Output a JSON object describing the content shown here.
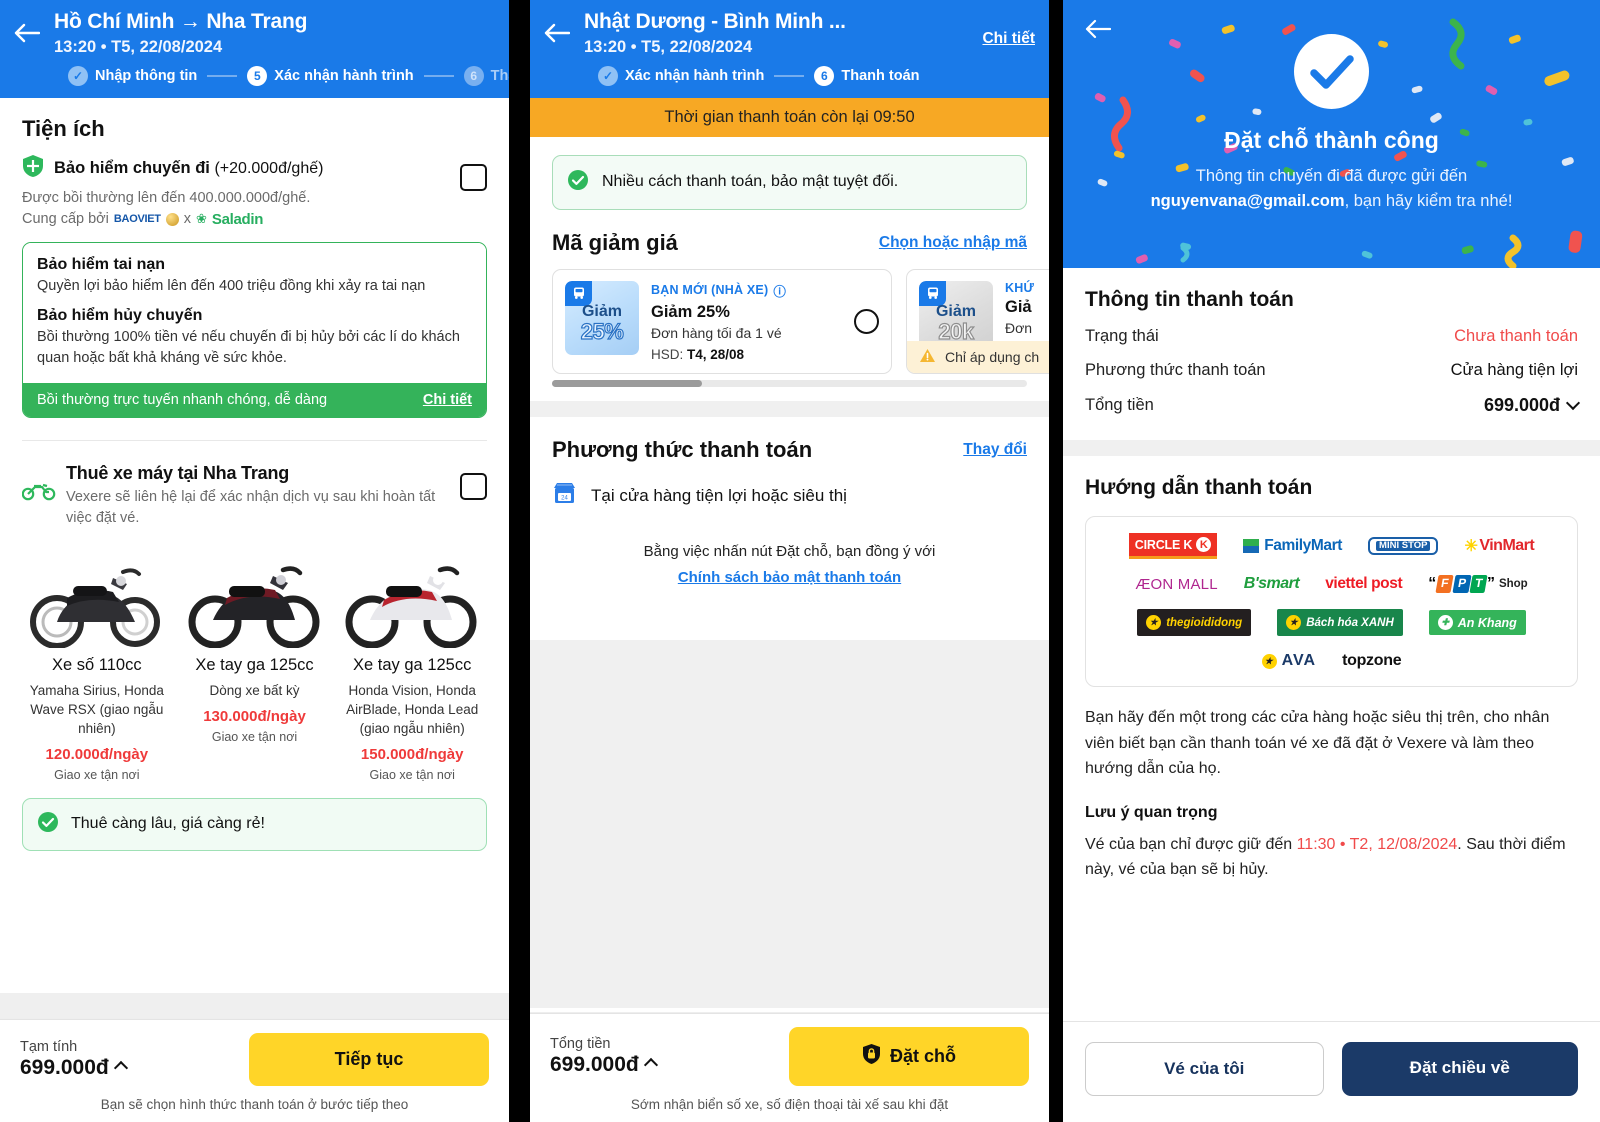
{
  "panel1": {
    "header": {
      "title": "Hồ Chí Minh → Nha Trang",
      "subtitle": "13:20 • T5, 22/08/2024",
      "steps": [
        {
          "bullet": "✓",
          "label": "Nhập thông tin",
          "state": "done"
        },
        {
          "bullet": "5",
          "label": "Xác nhận hành trình",
          "state": "current"
        },
        {
          "bullet": "6",
          "label": "Thanh",
          "state": "next"
        }
      ]
    },
    "section_title": "Tiện ích",
    "trip_insurance": {
      "title": "Bảo hiểm chuyến đi",
      "price_suffix": "(+20.000đ/ghế)",
      "desc": "Được bồi thường lên đến 400.000.000đ/ghế.",
      "provided_by_label": "Cung cấp bởi",
      "provider_1": "BAOVIET",
      "provider_sep": "x",
      "provider_2": "Saladin"
    },
    "insurance_card": {
      "accident_title": "Bảo hiểm tai nạn",
      "accident_desc": "Quyền lợi bảo hiểm lên đến 400 triệu đồng khi xảy ra tai nạn",
      "cancel_title": "Bảo hiểm hủy chuyến",
      "cancel_desc": "Bồi thường 100% tiền vé nếu chuyến đi bị hủy bởi các lí do khách quan hoặc bất khả kháng về sức khỏe.",
      "footer_text": "Bồi thường trực tuyến nhanh chóng, dễ dàng",
      "footer_link": "Chi tiết"
    },
    "bike_rental": {
      "title": "Thuê xe máy tại Nha Trang",
      "subtitle": "Vexere sẽ liên hệ lại để xác nhận dịch vụ sau khi hoàn tất việc đặt vé.",
      "items": [
        {
          "name": "Xe số 110cc",
          "models": "Yamaha Sirius, Honda Wave RSX (giao ngẫu nhiên)",
          "price": "120.000đ/ngày",
          "shipping": "Giao xe tận nơi"
        },
        {
          "name": "Xe tay ga 125cc",
          "models": "Dòng xe bất kỳ",
          "price": "130.000đ/ngày",
          "shipping": "Giao xe tận nơi"
        },
        {
          "name": "Xe tay ga 125cc",
          "models": "Honda Vision, Honda AirBlade, Honda Lead (giao ngẫu nhiên)",
          "price": "150.000đ/ngày",
          "shipping": "Giao xe tận nơi"
        }
      ],
      "hint": "Thuê càng lâu, giá càng rẻ!"
    },
    "bottom": {
      "label": "Tạm tính",
      "amount": "699.000đ",
      "cta": "Tiếp tục",
      "note": "Bạn sẽ chọn hình thức thanh toán ở bước tiếp theo"
    }
  },
  "panel2": {
    "header": {
      "title": "Nhật Dương - Bình Minh ...",
      "subtitle": "13:20 • T5, 22/08/2024",
      "right_link": "Chi tiết",
      "steps": [
        {
          "bullet": "✓",
          "label": "Xác nhận hành trình",
          "state": "done"
        },
        {
          "bullet": "6",
          "label": "Thanh toán",
          "state": "current"
        }
      ]
    },
    "timer": "Thời gian thanh toán còn lại 09:50",
    "secure_note": "Nhiều cách thanh toán, bảo mật tuyệt đối.",
    "promo": {
      "title": "Mã giảm giá",
      "link": "Chọn hoặc nhập mã",
      "coupons": [
        {
          "img_line1": "Giảm",
          "img_line2": "25%",
          "tag": "BẠN MỚI (NHÀ XE)",
          "title": "Giảm 25%",
          "sub": "Đơn hàng tối đa 1 vé",
          "expiry_label": "HSD:",
          "expiry": "T4, 28/08",
          "warning": ""
        },
        {
          "img_line1": "Giảm",
          "img_line2": "20k",
          "tag": "KHỨ",
          "title": "Giả",
          "sub": "Đơn",
          "expiry_label": "",
          "expiry": "",
          "warning": "Chỉ áp dụng ch"
        }
      ]
    },
    "payment": {
      "title": "Phương thức thanh toán",
      "change_link": "Thay đổi",
      "method": "Tại cửa hàng tiện lợi hoặc siêu thị",
      "agree_prefix": "Bằng việc nhấn nút Đặt chỗ, bạn đồng ý với",
      "agree_link": "Chính sách bảo mật thanh toán"
    },
    "bottom": {
      "label": "Tổng tiền",
      "amount": "699.000đ",
      "cta": "Đặt chỗ",
      "note": "Sớm nhận biển số xe, số điện thoại tài xế sau khi đặt"
    }
  },
  "panel3": {
    "hero": {
      "title": "Đặt chỗ thành công",
      "line1": "Thông tin chuyến đi đã được gửi đến",
      "email": "nguyenvana@gmail.com",
      "line2": ", bạn hãy kiểm tra nhé!"
    },
    "payment_info": {
      "title": "Thông tin thanh toán",
      "rows": [
        {
          "key": "Trạng thái",
          "value": "Chưa thanh toán",
          "style": "red"
        },
        {
          "key": "Phương thức thanh toán",
          "value": "Cửa hàng tiện lợi",
          "style": "plain"
        },
        {
          "key": "Tổng tiền",
          "value": "699.000đ",
          "style": "big"
        }
      ]
    },
    "guide": {
      "title": "Hướng dẫn thanh toán",
      "stores": [
        [
          "CIRCLE K",
          "FamilyMart",
          "MINI STOP",
          "VinMart"
        ],
        [
          "ÆON MALL",
          "B'smart",
          "viettel post",
          "FPT Shop"
        ],
        [
          "thegioididong",
          "Bách hóa XANH",
          "An Khang"
        ],
        [
          "AVA",
          "topzone"
        ]
      ],
      "paragraph": "Bạn hãy đến một trong các cửa hàng hoặc siêu thị trên, cho nhân viên biết bạn cần thanh toán vé xe đã đặt ở Vexere và làm theo hướng dẫn của họ.",
      "important_title": "Lưu ý quan trọng",
      "important_prefix": "Vé của bạn chỉ được giữ đến ",
      "important_deadline": "11:30 • T2, 12/08/2024",
      "important_suffix": ". Sau thời điểm này, vé của bạn sẽ bị hủy."
    },
    "bottom": {
      "secondary": "Vé của tôi",
      "primary": "Đặt chiều về"
    }
  },
  "colors": {
    "brand_blue": "#1a7ae8",
    "yellow": "#ffd528",
    "green": "#34b35a",
    "red": "#f04a4a",
    "navy": "#1b3a68",
    "orange": "#f7a824"
  }
}
